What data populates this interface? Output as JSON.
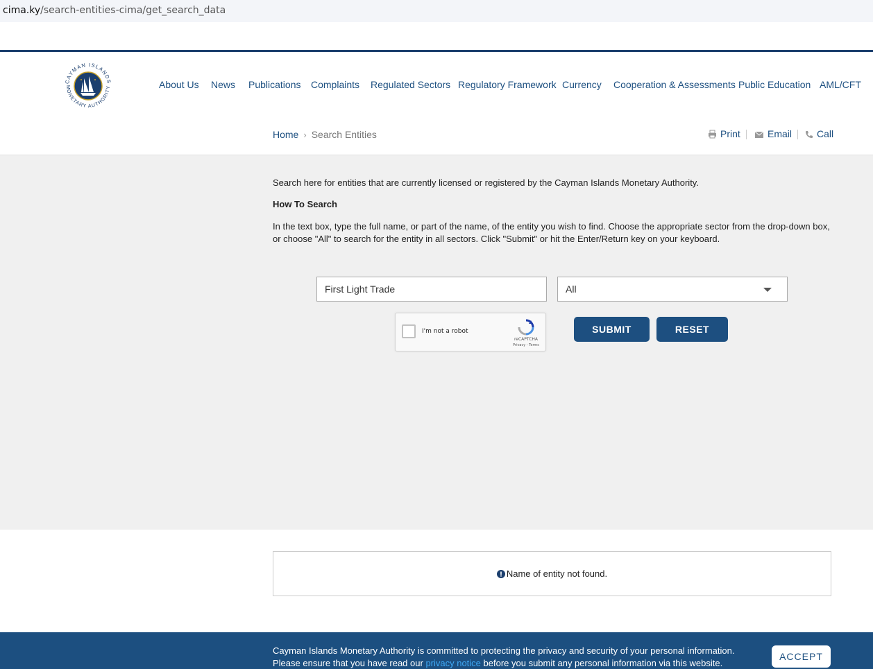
{
  "browser": {
    "url_host": "cima.ky",
    "url_path": "/search-entities-cima/get_search_data"
  },
  "logo": {
    "text_top": "CAYMAN ISLANDS",
    "text_bottom": "MONETARY AUTHORITY"
  },
  "nav": {
    "items": [
      "About Us",
      "News",
      "Publications",
      "Complaints",
      "Regulated Sectors",
      "Regulatory Framework",
      "Currency",
      "Cooperation & Assessments",
      "Public Education",
      "AML/CFT"
    ]
  },
  "breadcrumb": {
    "home": "Home",
    "current": "Search Entities"
  },
  "tools": {
    "print": "Print",
    "email": "Email",
    "call": "Call"
  },
  "content": {
    "intro": "Search here for entities that are currently licensed or registered by the Cayman Islands Monetary Authority.",
    "howto_title": "How To Search",
    "instructions": "In the text box, type the full name, or part of the name, of the entity you wish to find. Choose the appropriate sector from the drop-down box, or choose \"All\" to search for the entity in all sectors. Click \"Submit\" or hit the Enter/Return key on your keyboard."
  },
  "form": {
    "search_value": "First Light Trade",
    "sector_selected": "All",
    "captcha_label": "I'm not a robot",
    "captcha_brand": "reCAPTCHA",
    "captcha_terms": "Privacy - Terms",
    "submit_label": "SUBMIT",
    "reset_label": "RESET"
  },
  "result": {
    "message": "Name of entity not found."
  },
  "cookie": {
    "line1": "Cayman Islands Monetary Authority is committed to protecting the privacy and security of your personal information.",
    "line2_before": "Please ensure that you have read our ",
    "line2_link": "privacy notice",
    "line2_after": " before you submit any personal information via this website.",
    "accept_label": "ACCEPT"
  },
  "colors": {
    "brand_blue": "#1c4f80",
    "nav_text": "#1c4f80",
    "link_blue": "#3fa9f5",
    "panel_gray": "#f0f0f0"
  }
}
